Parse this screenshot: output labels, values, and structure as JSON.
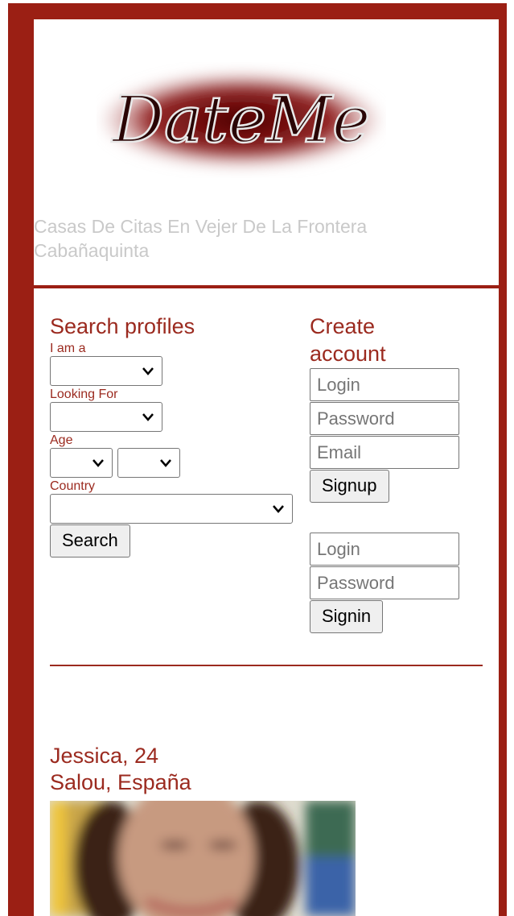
{
  "logo": {
    "text": "DateMe"
  },
  "header": {
    "tagline_line1": "Casas De Citas En Vejer De La Frontera",
    "tagline_line2": "Cabañaquinta"
  },
  "search": {
    "title": "Search profiles",
    "i_am_label": "I am a",
    "looking_for_label": "Looking For",
    "age_label": "Age",
    "country_label": "Country",
    "button_label": "Search"
  },
  "account": {
    "title_line1": "Create",
    "title_line2": "account",
    "signup_login_placeholder": "Login",
    "signup_password_placeholder": "Password",
    "signup_email_placeholder": "Email",
    "signup_button": "Signup",
    "signin_login_placeholder": "Login",
    "signin_password_placeholder": "Password",
    "signin_button": "Signin"
  },
  "profile": {
    "name_age": "Jessica, 24",
    "location": "Salou, España"
  },
  "colors": {
    "frame": "#9b1f14",
    "accent_text": "#9b2a1f"
  }
}
